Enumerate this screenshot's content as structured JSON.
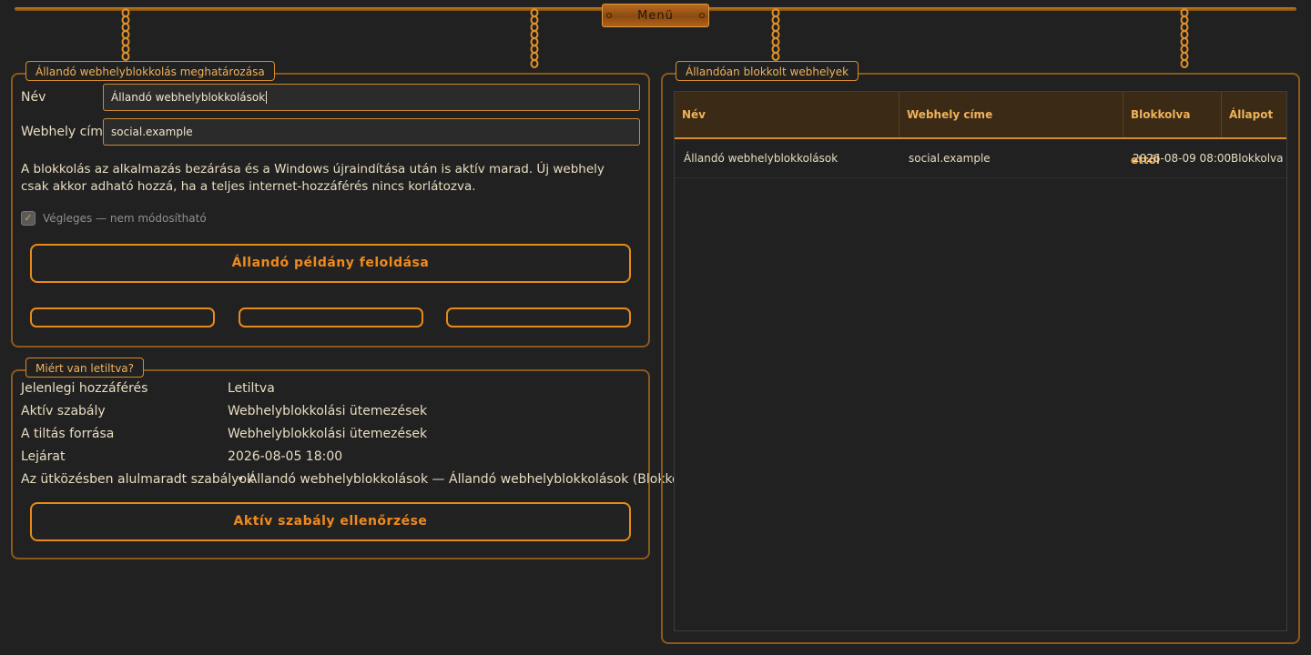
{
  "menu": {
    "label": "Menü"
  },
  "define_panel": {
    "title": "Állandó webhelyblokkolás meghatározása",
    "name_label": "Név",
    "name_value": "Állandó webhelyblokkolások",
    "site_label": "Webhely címe",
    "site_value": "social.example",
    "description": "A blokkolás az alkalmazás bezárása és a Windows újraindítása után is aktív marad. Új webhely csak akkor adható hozzá, ha a teljes internet-hozzáférés nincs korlátozva.",
    "final_checkbox_label": "Végleges — nem módosítható",
    "final_checked": true,
    "unlock_button": "Állandó példány feloldása",
    "small_buttons": [
      "",
      "",
      ""
    ]
  },
  "why_panel": {
    "title": "Miért van letiltva?",
    "rows": [
      {
        "key": "Jelenlegi hozzáférés",
        "value": "Letiltva"
      },
      {
        "key": "Aktív szabály",
        "value": "Webhelyblokkolási ütemezések"
      },
      {
        "key": "A tiltás forrása",
        "value": "Webhelyblokkolási ütemezések"
      },
      {
        "key": "Lejárat",
        "value": "2026-08-05 18:00"
      },
      {
        "key": "Az ütközésben alulmaradt szabályok",
        "value": "• Állandó webhelyblokkolások — Állandó webhelyblokkolások (Blokkolva)"
      }
    ],
    "check_button": "Aktív szabály ellenőrzése"
  },
  "blocked_panel": {
    "title": "Állandóan blokkolt webhelyek",
    "columns": [
      "Név",
      "Webhely címe",
      "Blokkolva ettől",
      "Állapot"
    ],
    "rows": [
      [
        "Állandó webhelyblokkolások",
        "social.example",
        "2026-08-09 08:00",
        "Blokkolva"
      ]
    ]
  },
  "colors": {
    "accent": "#e88a1a",
    "background": "#212121",
    "text": "#e8dcc0",
    "header": "#3a2a16"
  },
  "icons": {
    "chain": "chain-icon",
    "check": "checkmark-icon"
  }
}
